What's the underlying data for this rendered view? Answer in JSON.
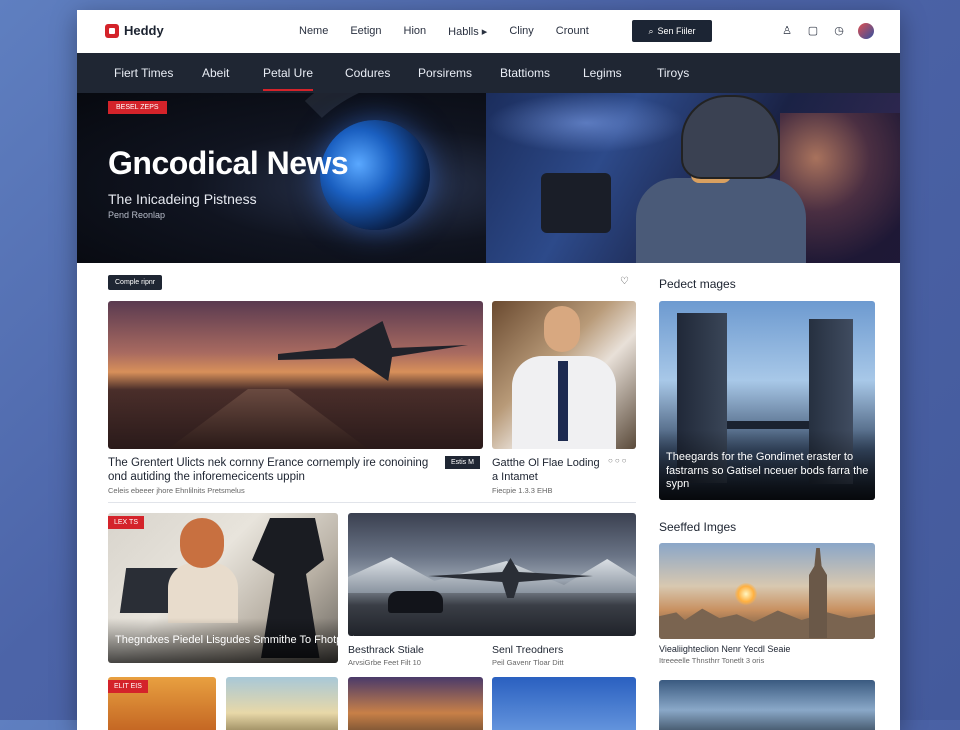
{
  "brand": {
    "name": "Heddy"
  },
  "topnav": [
    "Neme",
    "Eetign",
    "Hion",
    "Hablls ▸",
    "Cliny",
    "Crount"
  ],
  "search": {
    "label": "Sen Fiiler"
  },
  "mainnav": [
    "Fiert Times",
    "Abeit",
    "Petal Ure",
    "Codures",
    "Porsirems",
    "Btattioms",
    "Legims",
    "Tiroys"
  ],
  "mainnav_active": 2,
  "hero": {
    "badge": "BESEL ZEPS",
    "title": "Gncodical News",
    "subtitle": "The Inicadeing Pistness",
    "meta": "Pend Reonlap"
  },
  "section": {
    "tag": "Comple ripnr",
    "featured_caption": "The Grentert Ulicts nek cornny Erance cornemply ire conoining ond autiding the inforemecicents uppin",
    "featured_meta": "Celeis ebeeer jhore Ehnlilnits Pretsmelus",
    "featured_badge": "Estis M",
    "second_caption": "Gatthe Ol Flae Loding a Intamet",
    "second_meta": "Fiecpie 1.3.3 EHB",
    "dots": "○○○"
  },
  "sidebar": {
    "title1": "Pedect mages",
    "tower_caption": "Theegards for the Gondimet eraster to fastrarns so Gatisel nceuer bods farra the sypn",
    "title2": "Seeffed Imges"
  },
  "row2": {
    "studio_badge": "LEX TS",
    "studio_caption": "Thegndxes Piedel Lisgudes Smmithe To Fhotpert",
    "runway_caption1": "Besthrack Stiale",
    "runway_meta1": "ArvsiGrbe Feet Filt 10",
    "runway_caption2": "Senl Treodners",
    "runway_meta2": "Peil Gavenr Tloar Ditt",
    "city_caption": "Viealiighteclion Nenr Yecdl Seaie",
    "city_meta": "Itreeeelle Thnsthrr Tonetlt 3 oris"
  },
  "bottom": {
    "badge": "ELIT EIS"
  },
  "colors": {
    "accent": "#d4232a",
    "dark": "#1f2633"
  }
}
